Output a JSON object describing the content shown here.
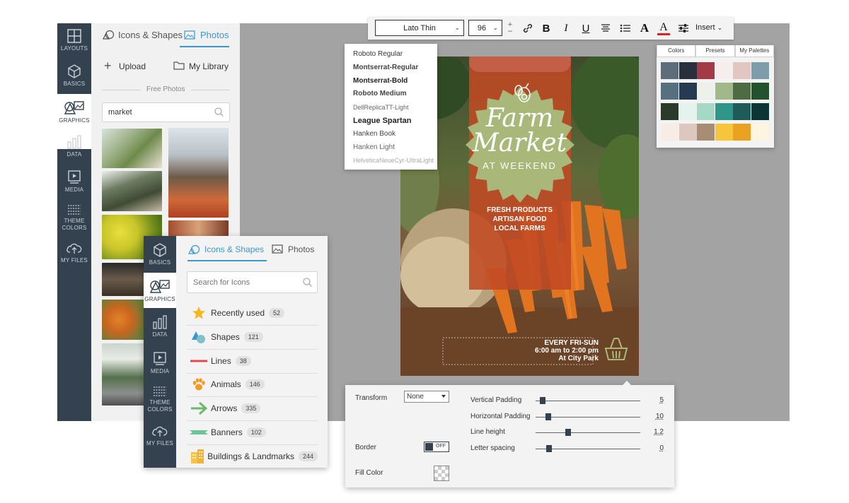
{
  "back_rail": {
    "items": [
      {
        "label": "LAYOUTS"
      },
      {
        "label": "BASICS"
      },
      {
        "label": "GRAPHICS"
      },
      {
        "label": "DATA"
      },
      {
        "label": "MEDIA"
      },
      {
        "label": "THEME COLORS"
      },
      {
        "label": "MY FILES"
      }
    ]
  },
  "back_panel": {
    "tabs": [
      {
        "label": "Icons & Shapes"
      },
      {
        "label": "Photos"
      }
    ],
    "upload_label": "Upload",
    "library_label": "My Library",
    "section_label": "Free Photos",
    "search_value": "market"
  },
  "toolbar": {
    "font": "Lato Thin",
    "size": "96",
    "insert_label": "Insert",
    "bold": "B",
    "italic": "I",
    "underline": "U",
    "font_color_glyph": "A",
    "text_glyph": "A"
  },
  "font_dropdown": {
    "options": [
      {
        "label": "Roboto Regular"
      },
      {
        "label": "Montserrat-Regular"
      },
      {
        "label": "Montserrat-Bold"
      },
      {
        "label": "Roboto Medium"
      },
      {
        "label": "DellReplicaTT-Light"
      },
      {
        "label": "League Spartan"
      },
      {
        "label": "Hanken Book"
      },
      {
        "label": "Hanken Light"
      },
      {
        "label": "HelveticaNeueCyr-UltraLight"
      }
    ]
  },
  "palette": {
    "tabs": [
      {
        "label": "Colors"
      },
      {
        "label": "Presets"
      },
      {
        "label": "My Palettes"
      }
    ],
    "rows": [
      [
        "#5e6d7a",
        "#2a2f3d",
        "#a23b47",
        "#f6eeec",
        "#e2c6c1",
        "#7f9cab"
      ],
      [
        "#56707f",
        "#263b52",
        "#eef0ea",
        "#a1b88a",
        "#4f6b44",
        "#23522f"
      ],
      [
        "#2b3a2b",
        "#e5f3ee",
        "#a6d9c5",
        "#2f968a",
        "#1f5c59",
        "#0c3536"
      ],
      [
        "#f7ede4",
        "#ddc8bf",
        "#a88c73",
        "#f7c53b",
        "#eaa021",
        "#fdf5df"
      ]
    ]
  },
  "poster": {
    "title_line1": "Farm",
    "title_line2": "Market",
    "subtitle": "AT WEEKEND",
    "lines": [
      "FRESH PRODUCTS",
      "ARTISAN FOOD",
      "LOCAL FARMS"
    ],
    "footer": [
      "EVERY FRI-SUN",
      "6:00 am to 2:00 pm",
      "At City Park"
    ],
    "colors": {
      "banner": "#c04a23",
      "badge": "#a9b779",
      "accent": "#a9b779"
    }
  },
  "front_rail": {
    "items": [
      {
        "label": "BASICS"
      },
      {
        "label": "GRAPHICS"
      },
      {
        "label": "DATA"
      },
      {
        "label": "MEDIA"
      },
      {
        "label": "THEME COLORS"
      },
      {
        "label": "MY FILES"
      }
    ]
  },
  "front_panel": {
    "tabs": [
      {
        "label": "Icons & Shapes"
      },
      {
        "label": "Photos"
      }
    ],
    "search_placeholder": "Search for Icons",
    "categories": [
      {
        "label": "Recently used",
        "count": "52",
        "icon": "star-icon"
      },
      {
        "label": "Shapes",
        "count": "121",
        "icon": "shapes-icon"
      },
      {
        "label": "Lines",
        "count": "38",
        "icon": "line-icon"
      },
      {
        "label": "Animals",
        "count": "146",
        "icon": "paw-icon"
      },
      {
        "label": "Arrows",
        "count": "335",
        "icon": "arrow-icon"
      },
      {
        "label": "Banners",
        "count": "102",
        "icon": "banner-icon"
      },
      {
        "label": "Buildings & Landmarks",
        "count": "244",
        "icon": "building-icon"
      }
    ]
  },
  "props": {
    "transform_label": "Transform",
    "transform_value": "None",
    "border_label": "Border",
    "border_toggle": "OFF",
    "fill_label": "Fill Color",
    "sliders": [
      {
        "label": "Vertical Padding",
        "value": "5",
        "fraction": 0.07
      },
      {
        "label": "Horizontal Padding",
        "value": "10",
        "fraction": 0.12
      },
      {
        "label": "Line height",
        "value": "1.2",
        "fraction": 0.31
      },
      {
        "label": "Letter spacing",
        "value": "0",
        "fraction": 0.13
      }
    ]
  }
}
